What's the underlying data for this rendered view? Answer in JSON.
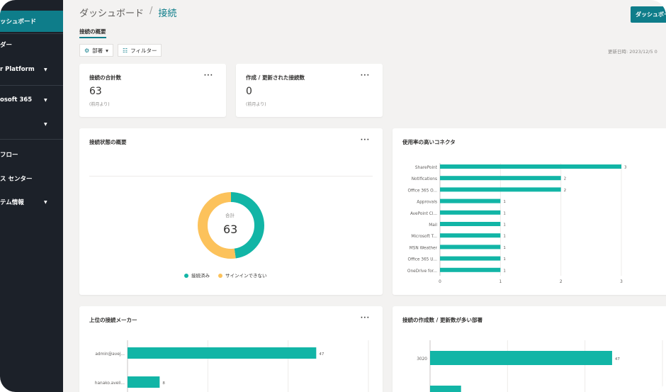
{
  "sidebar": {
    "top_faded": "･･･",
    "items": [
      {
        "label": "ッシュボード",
        "chevron": "",
        "active": true
      },
      {
        "label": "ダー",
        "chevron": "",
        "active": false
      },
      {
        "label": "r Platform",
        "chevron": "▼",
        "active": false
      },
      {
        "label": "osoft 365",
        "chevron": "▼",
        "active": false
      },
      {
        "label": "",
        "chevron": "▼",
        "active": false
      },
      {
        "label": "フロー",
        "chevron": "",
        "active": false
      },
      {
        "label": "ス センター",
        "chevron": "",
        "active": false
      },
      {
        "label": "テム情報",
        "chevron": "▼",
        "active": false
      }
    ]
  },
  "header": {
    "breadcrumb_root": "ダッシュボード",
    "breadcrumb_sep": "/",
    "breadcrumb_current": "接続",
    "top_button": "ダッシュボード"
  },
  "section_tab": "接続の概要",
  "toolbar": {
    "gear_icon": "⚙",
    "scope_label": "部署",
    "scope_caret": "▾",
    "filter_icon": "☷",
    "filter_label": "フィルター",
    "updated": "更新日時: 2023/12/5 0"
  },
  "kpi": [
    {
      "title": "接続の合計数",
      "value": "63",
      "sub": "(前月より)",
      "more": "···"
    },
    {
      "title": "作成 / 更新された接続数",
      "value": "0",
      "sub": "(前月より)",
      "more": "···"
    }
  ],
  "status_card": {
    "title": "接続状態の概要",
    "more": "···",
    "center_label": "合計",
    "center_value": "63",
    "legend": [
      {
        "label": "接続済み",
        "color": "#12b5a6"
      },
      {
        "label": "サインインできない",
        "color": "#fcc25b"
      }
    ]
  },
  "usage_card": {
    "title": "使用率の高いコネクタ"
  },
  "makers_card": {
    "title": "上位の接続メーカー",
    "more": "···"
  },
  "dept_card": {
    "title": "接続の作成数 / 更新数が多い部署"
  },
  "colors": {
    "teal": "#12b5a6",
    "yellow": "#fcc25b",
    "accent": "#0e7d8a"
  },
  "chart_data": [
    {
      "type": "pie",
      "labels": [
        "接続済み",
        "サインインできない"
      ],
      "values": [
        30,
        33
      ],
      "center_text": "63"
    },
    {
      "type": "bar",
      "orientation": "horizontal",
      "title": "使用率の高いコネクタ",
      "categories": [
        "SharePoint",
        "Notifications",
        "Office 365 O...",
        "Approvals",
        "AvePoint Cl...",
        "Mail",
        "Microsoft T...",
        "MSN Weather",
        "Office 365 U...",
        "OneDrive for..."
      ],
      "values": [
        3,
        2,
        2,
        1,
        1,
        1,
        1,
        1,
        1,
        1
      ],
      "xlim": [
        0,
        3
      ],
      "xticks": [
        "0",
        "1",
        "2",
        "3"
      ]
    },
    {
      "type": "bar",
      "orientation": "horizontal",
      "title": "上位の接続メーカー",
      "categories": [
        "admin@avej...",
        "hanako.aveli..."
      ],
      "values": [
        47,
        8
      ],
      "xlim": [
        0,
        60
      ]
    },
    {
      "type": "bar",
      "orientation": "horizontal",
      "title": "接続の作成数 / 更新数が多い部署",
      "categories": [
        "3020",
        ""
      ],
      "values": [
        47,
        8
      ],
      "value_labels": [
        "47",
        ""
      ],
      "xlim": [
        0,
        60
      ]
    }
  ]
}
